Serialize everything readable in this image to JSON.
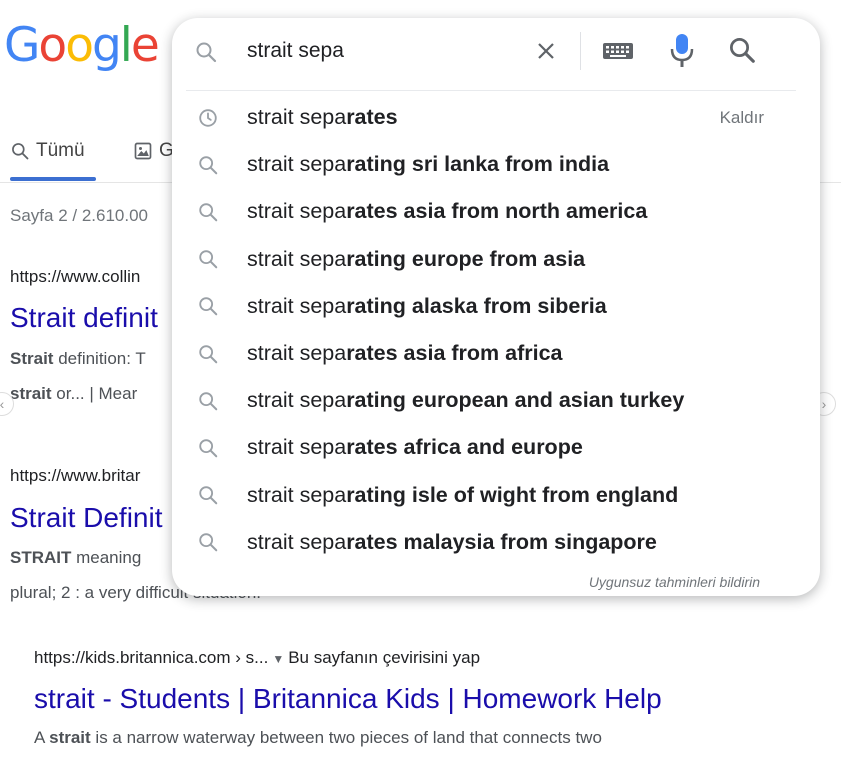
{
  "logo": {
    "text": [
      "G",
      "o",
      "o",
      "g",
      "l",
      "e"
    ],
    "colors": [
      "#4285f4",
      "#ea4335",
      "#fbbc05",
      "#4285f4",
      "#34a853",
      "#ea4335"
    ]
  },
  "tabs": {
    "all_label": "Tümü",
    "images_label": "G"
  },
  "stats": "Sayfa 2 / 2.610.00",
  "results": [
    {
      "url": "https://www.collin",
      "title": "Strait definit",
      "snippet_1_bold": "Strait",
      "snippet_1_rest": " definition: T",
      "snippet_2_bold": "strait",
      "snippet_2_rest": " or... | Mear"
    },
    {
      "url": "https://www.britar",
      "title": "Strait Definit",
      "snippet_1_bold": "STRAIT",
      "snippet_1_rest": " meaning",
      "snippet_2": "plural; 2 : a very difficult situation."
    },
    {
      "url": "https://kids.britannica.com › s...",
      "translate": "Bu sayfanın çevirisini yap",
      "title": "strait - Students | Britannica Kids | Homework Help",
      "snippet_pre": "A ",
      "snippet_bold": "strait",
      "snippet_rest": " is a narrow waterway between two pieces of land that connects two"
    }
  ],
  "search": {
    "query": "strait sepa",
    "suggestions": [
      {
        "typed": "strait sepa",
        "completion": "rates",
        "icon": "history-icon",
        "remove_label": "Kaldır"
      },
      {
        "typed": "strait sepa",
        "completion": "rating sri lanka from india",
        "icon": "search-icon"
      },
      {
        "typed": "strait sepa",
        "completion": "rates asia from north america",
        "icon": "search-icon"
      },
      {
        "typed": "strait sepa",
        "completion": "rating europe from asia",
        "icon": "search-icon"
      },
      {
        "typed": "strait sepa",
        "completion": "rating alaska from siberia",
        "icon": "search-icon"
      },
      {
        "typed": "strait sepa",
        "completion": "rates asia from africa",
        "icon": "search-icon"
      },
      {
        "typed": "strait sepa",
        "completion": "rating european and asian turkey",
        "icon": "search-icon"
      },
      {
        "typed": "strait sepa",
        "completion": "rates africa and europe",
        "icon": "search-icon"
      },
      {
        "typed": "strait sepa",
        "completion": "rating isle of wight from england",
        "icon": "search-icon"
      },
      {
        "typed": "strait sepa",
        "completion": "rates malaysia from singapore",
        "icon": "search-icon"
      }
    ],
    "report_label": "Uygunsuz tahminleri bildirin"
  },
  "colors": {
    "link": "#1a0dab",
    "accent": "#4285f4",
    "mic_blue": "#4285f4",
    "icon_gray": "#9aa0a6"
  }
}
